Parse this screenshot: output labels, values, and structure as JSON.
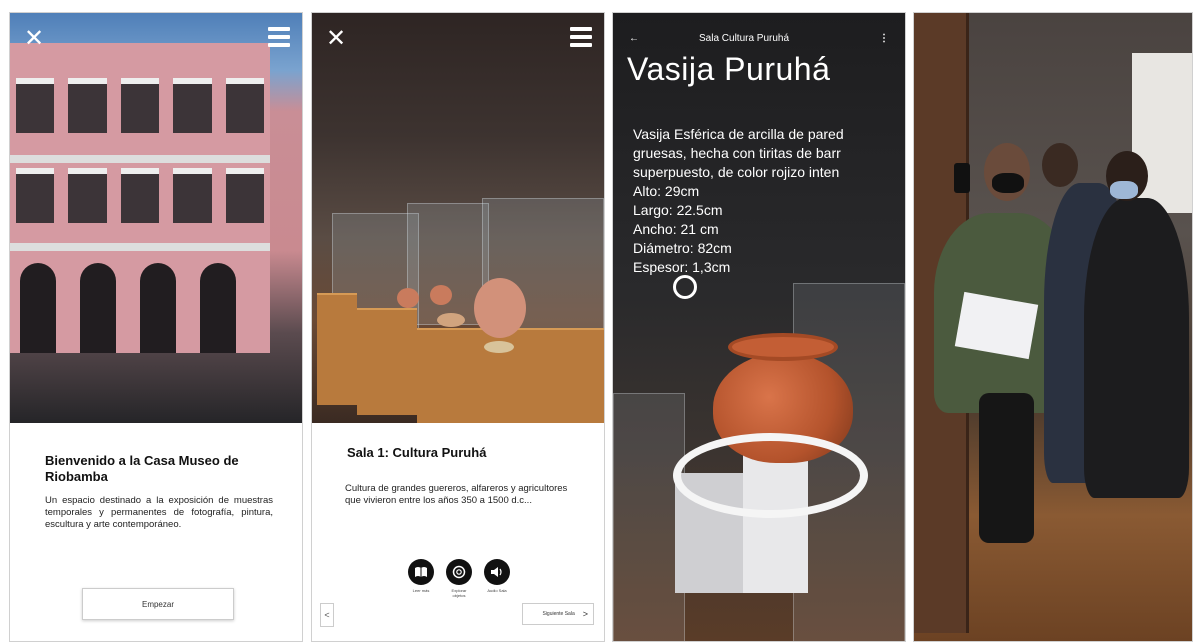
{
  "screen1": {
    "close_icon": "close-icon",
    "menu_icon": "menu-icon",
    "title": "Bienvenido a la Casa Museo de Riobamba",
    "description": "Un espacio destinado a la exposición de muestras temporales y permanentes de fotografía, pintura, escultura y arte contemporáneo.",
    "start_button": "Empezar"
  },
  "screen2": {
    "close_icon": "close-icon",
    "menu_icon": "menu-icon",
    "title": "Sala 1: Cultura Puruhá",
    "description": "Cultura de grandes guereros, alfareros y agricultores que vivieron entre los años 350 a 1500 d.c...",
    "actions": [
      {
        "icon": "book-icon",
        "label": "Leer más"
      },
      {
        "icon": "ar-object-icon",
        "label": "Explorar objetos"
      },
      {
        "icon": "audio-icon",
        "label": "Audio Sala"
      }
    ],
    "prev_symbol": "<",
    "next_label": "Siguiente Sala",
    "next_symbol": ">"
  },
  "screen3": {
    "back_symbol": "←",
    "header_title": "Sala Cultura Puruhá",
    "menu_symbol": "⋮",
    "object_title": "Vasija Puruhá",
    "lines": [
      "Vasija Esférica de arcilla de pared",
      "gruesas, hecha con tiritas de barr",
      "superpuesto, de color rojizo inten",
      "Alto: 29cm",
      "Largo: 22.5cm",
      "Ancho: 21 cm",
      "Diámetro: 82cm",
      "Espesor: 1,3cm"
    ]
  },
  "colors": {
    "accent_dark": "#111111",
    "card_bg": "#ffffff",
    "terracotta": "#c35e35"
  }
}
